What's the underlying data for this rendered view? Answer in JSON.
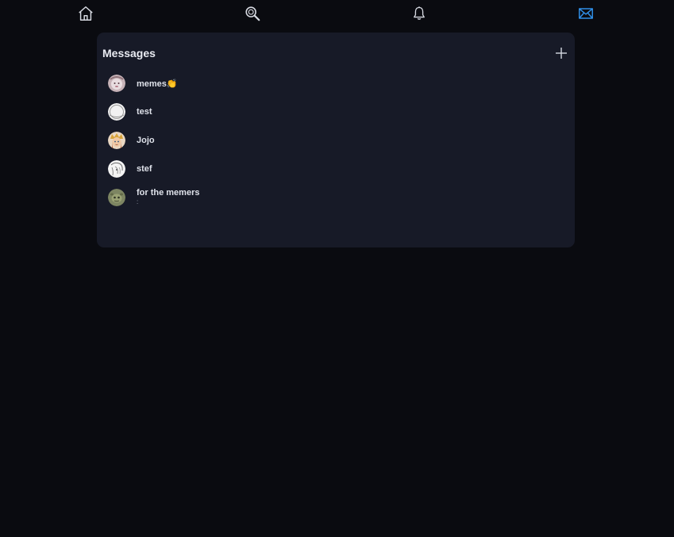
{
  "nav": {
    "items": [
      {
        "icon": "home-icon"
      },
      {
        "icon": "search-icon"
      },
      {
        "icon": "bell-icon"
      },
      {
        "icon": "mail-icon",
        "active": true
      }
    ],
    "icon_color": "#d7dae2",
    "active_color": "#2f8ee6"
  },
  "messages": {
    "title": "Messages",
    "new_icon": "plus-icon",
    "conversations": [
      {
        "name": "memes",
        "emoji": "👏",
        "preview": ""
      },
      {
        "name": "test",
        "emoji": "",
        "preview": ""
      },
      {
        "name": "Jojo",
        "emoji": "",
        "preview": ""
      },
      {
        "name": "stef",
        "emoji": "",
        "preview": ""
      },
      {
        "name": "for the memers",
        "emoji": "",
        "preview": ":"
      }
    ]
  },
  "colors": {
    "background": "#0a0b10",
    "panel": "#171a27",
    "text": "#e6e8ee"
  }
}
